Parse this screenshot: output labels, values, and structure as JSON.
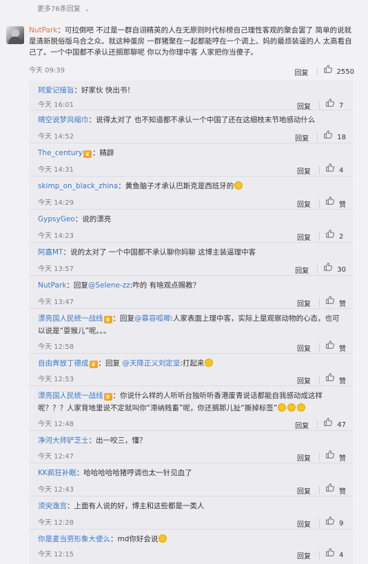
{
  "more_replies": {
    "label": "更多76条回复"
  },
  "main_comment": {
    "user": "NutPark",
    "text": "：可拉倒吧 不过是一群自诩精英的人在无原则时代标榜自己理性客观的聚会罢了 简单的说就是清新脱俗版乌合之众。就这种蛋房 一群猪聚在一起都能哼在一个调上。妈的最烦装逼的人 太高看自己了。一个中国都不承认还搁那聊呢 你以为你理中客 人家把你当傻子。",
    "time": "今天 09:39",
    "reply_label": "回复",
    "likes": "2550"
  },
  "replies": [
    {
      "user": "珂爱记接旨",
      "text": "：好家伙 快出书！",
      "time": "今天 16:01",
      "reply_label": "回复",
      "likes": "7"
    },
    {
      "user": "晴空说梦风缩巾",
      "text": "：说得太对了 也不知道都不承认一个中国了还在这细枝末节地感动什么",
      "time": "今天 14:52",
      "reply_label": "回复",
      "likes": "18"
    },
    {
      "user": "The_century",
      "text": "：精辟",
      "time": "今天 14:31",
      "reply_label": "回复",
      "likes": "4"
    },
    {
      "user": "skimp_on_black_zhina",
      "text": "：黄鱼脑子才承认巴斯克是西班牙的",
      "time": "今天 14:29",
      "reply_label": "回复",
      "likes": "赞"
    },
    {
      "user": "GypsyGeo",
      "text": "：说的漂亮",
      "time": "今天 14:23",
      "reply_label": "回复",
      "likes": "2"
    },
    {
      "user": "阿嘉MT",
      "text": "：说的太对了 一个中国都不承认聊你妈聊 这博主装逼理中客",
      "time": "今天 13:57",
      "reply_label": "回复",
      "likes": "30"
    },
    {
      "user": "NutPark",
      "text_a": "：回复",
      "mention": "@Selene-zz",
      "text_b": ":咋的 有啥观点赐教？",
      "time": "今天 13:47",
      "reply_label": "回复",
      "likes": "赞"
    },
    {
      "user": "漂亮国人民统一战线",
      "text_a": "：回复",
      "mention": "@慕容呱唧",
      "text_b": ":人家表面上理中客，实际上是观察动物的心态，也可以说是“耍猴儿”呢。。。",
      "time": "今天 12:58",
      "reply_label": "回复",
      "likes": "赞"
    },
    {
      "user": "自由奔放丁德成",
      "text_a": "：回复 ",
      "mention": "@天降正义刘定坚",
      "text_b": ":打起来",
      "time": "今天 12:53",
      "reply_label": "回复",
      "likes": "赞"
    },
    {
      "user": "漂亮国人民统一战线",
      "text": "：你说什么样的人听听台独听听香港废青说话都能自我感动成这样呢？？？人家背地里说不定就叫你“滞纳贱畜”呢，你还搁那儿扯“撕掉标签”",
      "time": "今天 12:48",
      "reply_label": "回复",
      "likes": "47"
    },
    {
      "user": "净河大师铲芝士",
      "text": "：出一咬三，懂？",
      "time": "今天 12:47",
      "reply_label": "回复",
      "likes": "赞"
    },
    {
      "user": "KK疯狂补眠",
      "text": "：哈哈哈哈哈猪哼调也太一针见血了",
      "time": "今天 12:43",
      "reply_label": "回复",
      "likes": "赞"
    },
    {
      "user": "须臾逸宫",
      "text": "：上面有人说的好，博主和这些都是一类人",
      "time": "今天 12:28",
      "reply_label": "回复",
      "likes": "9"
    },
    {
      "user": "你是麦当劳形象大使么",
      "text": "：md你好会说",
      "time": "今天 12:15",
      "reply_label": "回复",
      "likes": "4"
    }
  ]
}
